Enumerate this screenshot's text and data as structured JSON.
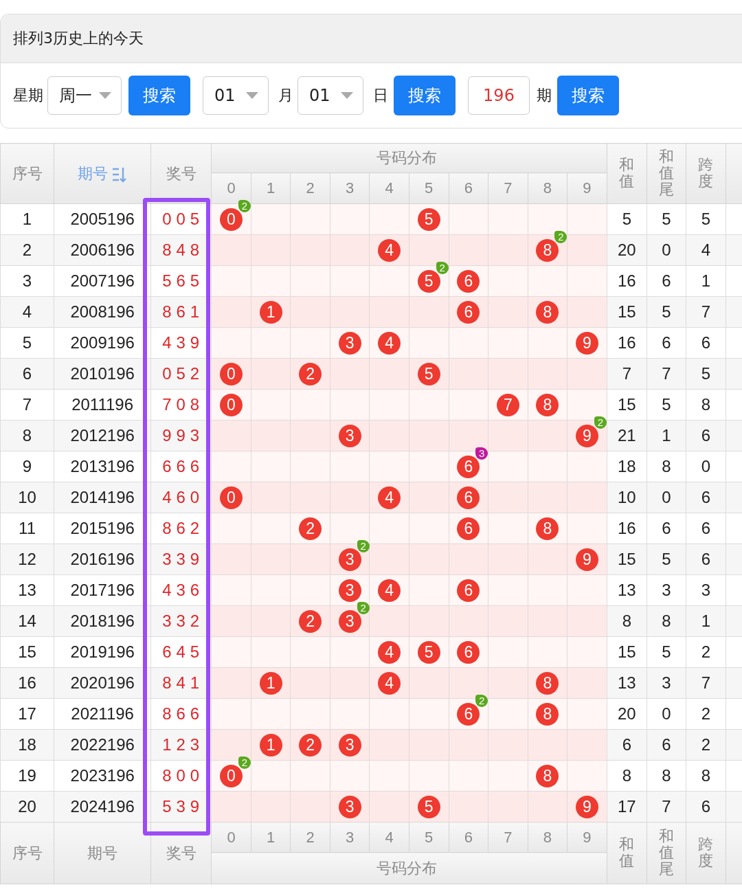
{
  "title": "排列3历史上的今天",
  "controls": [
    {
      "kind": "label",
      "text": "星期"
    },
    {
      "kind": "select",
      "text": "周一"
    },
    {
      "kind": "button",
      "text": "搜索"
    },
    {
      "kind": "select",
      "text": "01"
    },
    {
      "kind": "label",
      "text": "月"
    },
    {
      "kind": "select",
      "text": "01"
    },
    {
      "kind": "label",
      "text": "日"
    },
    {
      "kind": "button",
      "text": "搜索"
    },
    {
      "kind": "input",
      "text": "196"
    },
    {
      "kind": "label",
      "text": "期"
    },
    {
      "kind": "button",
      "text": "搜索"
    }
  ],
  "table": {
    "head_columns": [
      {
        "label": "序号",
        "sorted": false,
        "highlighted": false
      },
      {
        "label": "期号",
        "sorted": true,
        "highlighted": false
      },
      {
        "label": "奖号",
        "sorted": false,
        "highlighted": true
      }
    ],
    "distribution_label": "号码分布",
    "digits": [
      "0",
      "1",
      "2",
      "3",
      "4",
      "5",
      "6",
      "7",
      "8",
      "9"
    ],
    "stat_columns": [
      "和值",
      "和值尾",
      "跨度"
    ],
    "rows": [
      {
        "no": "1",
        "issue": "2005196",
        "number": "005",
        "balls": [
          {
            "digit": "0",
            "count": "2"
          },
          {
            "digit": "5"
          }
        ],
        "sum": "5",
        "sum_tail": "5",
        "span": "5"
      },
      {
        "no": "2",
        "issue": "2006196",
        "number": "848",
        "balls": [
          {
            "digit": "4"
          },
          {
            "digit": "8",
            "count": "2"
          }
        ],
        "sum": "20",
        "sum_tail": "0",
        "span": "4"
      },
      {
        "no": "3",
        "issue": "2007196",
        "number": "565",
        "balls": [
          {
            "digit": "5",
            "count": "2"
          },
          {
            "digit": "6"
          }
        ],
        "sum": "16",
        "sum_tail": "6",
        "span": "1"
      },
      {
        "no": "4",
        "issue": "2008196",
        "number": "861",
        "balls": [
          {
            "digit": "1"
          },
          {
            "digit": "6"
          },
          {
            "digit": "8"
          }
        ],
        "sum": "15",
        "sum_tail": "5",
        "span": "7"
      },
      {
        "no": "5",
        "issue": "2009196",
        "number": "439",
        "balls": [
          {
            "digit": "3"
          },
          {
            "digit": "4"
          },
          {
            "digit": "9"
          }
        ],
        "sum": "16",
        "sum_tail": "6",
        "span": "6"
      },
      {
        "no": "6",
        "issue": "2010196",
        "number": "052",
        "balls": [
          {
            "digit": "0"
          },
          {
            "digit": "2"
          },
          {
            "digit": "5"
          }
        ],
        "sum": "7",
        "sum_tail": "7",
        "span": "5"
      },
      {
        "no": "7",
        "issue": "2011196",
        "number": "708",
        "balls": [
          {
            "digit": "0"
          },
          {
            "digit": "7"
          },
          {
            "digit": "8"
          }
        ],
        "sum": "15",
        "sum_tail": "5",
        "span": "8"
      },
      {
        "no": "8",
        "issue": "2012196",
        "number": "993",
        "balls": [
          {
            "digit": "3"
          },
          {
            "digit": "9",
            "count": "2"
          }
        ],
        "sum": "21",
        "sum_tail": "1",
        "span": "6"
      },
      {
        "no": "9",
        "issue": "2013196",
        "number": "666",
        "balls": [
          {
            "digit": "6",
            "count": "3"
          }
        ],
        "sum": "18",
        "sum_tail": "8",
        "span": "0"
      },
      {
        "no": "10",
        "issue": "2014196",
        "number": "460",
        "balls": [
          {
            "digit": "0"
          },
          {
            "digit": "4"
          },
          {
            "digit": "6"
          }
        ],
        "sum": "10",
        "sum_tail": "0",
        "span": "6"
      },
      {
        "no": "11",
        "issue": "2015196",
        "number": "862",
        "balls": [
          {
            "digit": "2"
          },
          {
            "digit": "6"
          },
          {
            "digit": "8"
          }
        ],
        "sum": "16",
        "sum_tail": "6",
        "span": "6"
      },
      {
        "no": "12",
        "issue": "2016196",
        "number": "339",
        "balls": [
          {
            "digit": "3",
            "count": "2"
          },
          {
            "digit": "9"
          }
        ],
        "sum": "15",
        "sum_tail": "5",
        "span": "6"
      },
      {
        "no": "13",
        "issue": "2017196",
        "number": "436",
        "balls": [
          {
            "digit": "3"
          },
          {
            "digit": "4"
          },
          {
            "digit": "6"
          }
        ],
        "sum": "13",
        "sum_tail": "3",
        "span": "3"
      },
      {
        "no": "14",
        "issue": "2018196",
        "number": "332",
        "balls": [
          {
            "digit": "2"
          },
          {
            "digit": "3",
            "count": "2"
          }
        ],
        "sum": "8",
        "sum_tail": "8",
        "span": "1"
      },
      {
        "no": "15",
        "issue": "2019196",
        "number": "645",
        "balls": [
          {
            "digit": "4"
          },
          {
            "digit": "5"
          },
          {
            "digit": "6"
          }
        ],
        "sum": "15",
        "sum_tail": "5",
        "span": "2"
      },
      {
        "no": "16",
        "issue": "2020196",
        "number": "841",
        "balls": [
          {
            "digit": "1"
          },
          {
            "digit": "4"
          },
          {
            "digit": "8"
          }
        ],
        "sum": "13",
        "sum_tail": "3",
        "span": "7"
      },
      {
        "no": "17",
        "issue": "2021196",
        "number": "866",
        "balls": [
          {
            "digit": "6",
            "count": "2"
          },
          {
            "digit": "8"
          }
        ],
        "sum": "20",
        "sum_tail": "0",
        "span": "2"
      },
      {
        "no": "18",
        "issue": "2022196",
        "number": "123",
        "balls": [
          {
            "digit": "1"
          },
          {
            "digit": "2"
          },
          {
            "digit": "3"
          }
        ],
        "sum": "6",
        "sum_tail": "6",
        "span": "2"
      },
      {
        "no": "19",
        "issue": "2023196",
        "number": "800",
        "balls": [
          {
            "digit": "0",
            "count": "2"
          },
          {
            "digit": "8"
          }
        ],
        "sum": "8",
        "sum_tail": "8",
        "span": "8"
      },
      {
        "no": "20",
        "issue": "2024196",
        "number": "539",
        "balls": [
          {
            "digit": "3"
          },
          {
            "digit": "5"
          },
          {
            "digit": "9"
          }
        ],
        "sum": "17",
        "sum_tail": "7",
        "span": "6"
      }
    ],
    "footer": {
      "columns": [
        "序号",
        "期号",
        "奖号"
      ],
      "digits": [
        "0",
        "1",
        "2",
        "3",
        "4",
        "5",
        "6",
        "7",
        "8",
        "9"
      ],
      "distribution_label": "号码分布",
      "stat_columns": [
        "和值",
        "和值尾",
        "跨度"
      ]
    }
  }
}
